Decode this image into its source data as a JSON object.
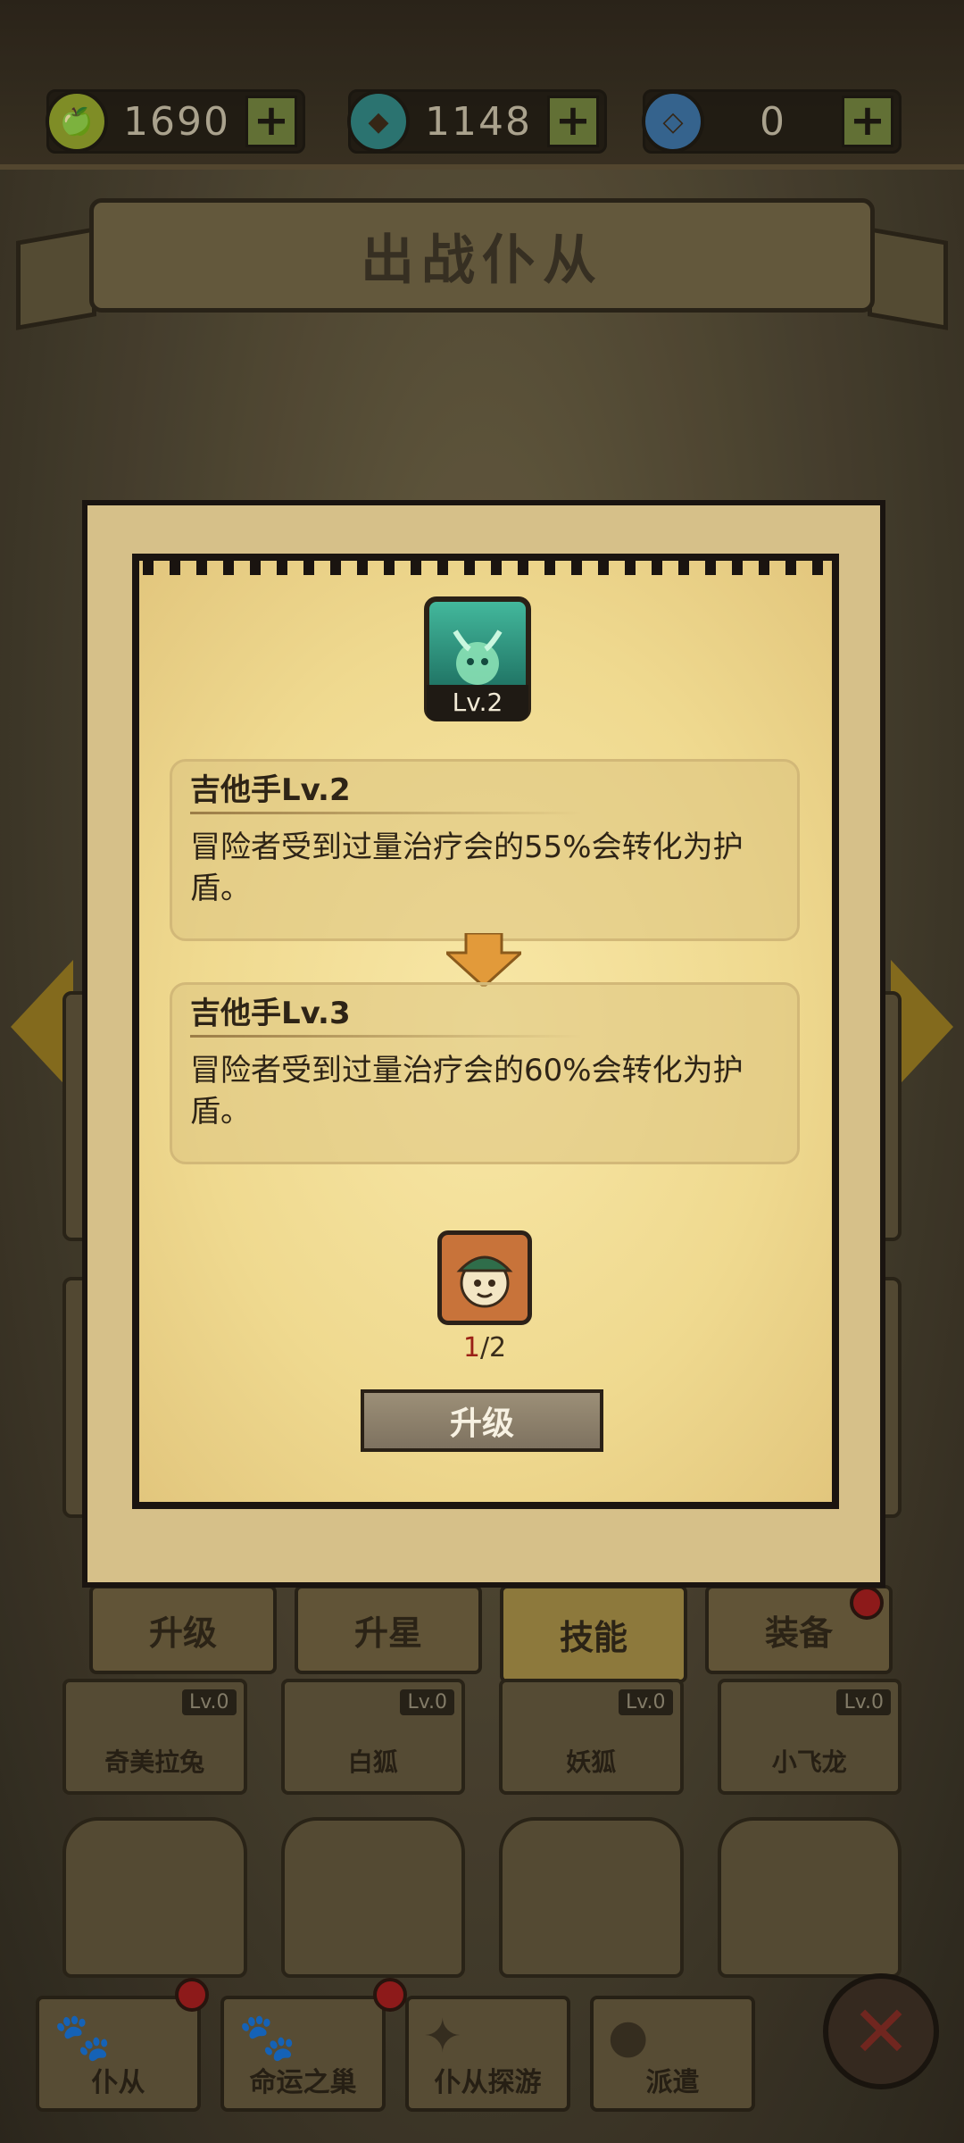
{
  "resources": [
    {
      "name": "gold-apple",
      "value": "1690",
      "color": "#8a9a2a"
    },
    {
      "name": "crystal",
      "value": "1148",
      "color": "#2f7d7a"
    },
    {
      "name": "gem",
      "value": "0",
      "color": "#3a6c9a"
    }
  ],
  "header": {
    "title": "出战仆从"
  },
  "tabs": [
    {
      "label": "升级"
    },
    {
      "label": "升星"
    },
    {
      "label": "技能",
      "active": true
    },
    {
      "label": "装备"
    }
  ],
  "units": [
    {
      "name": "奇美拉兔",
      "level": "Lv.0"
    },
    {
      "name": "白狐",
      "level": "Lv.0"
    },
    {
      "name": "妖狐",
      "level": "Lv.0"
    },
    {
      "name": "小飞龙",
      "level": "Lv.0"
    }
  ],
  "bottom_nav": [
    {
      "label": "仆从",
      "icon": "paw-icon"
    },
    {
      "label": "命运之巢",
      "icon": "paw-icon"
    },
    {
      "label": "仆从探游",
      "icon": "compass-icon"
    },
    {
      "label": "派遣",
      "icon": "people-icon"
    }
  ],
  "dialog": {
    "skill_level": "Lv.2",
    "current": {
      "title": "吉他手Lv.2",
      "description": "冒险者受到过量治疗会的55%会转化为护盾。"
    },
    "next": {
      "title": "吉他手Lv.3",
      "description": "冒险者受到过量治疗会的60%会转化为护盾。"
    },
    "material": {
      "have": "1",
      "need": "/2"
    },
    "upgrade_label": "升级"
  }
}
